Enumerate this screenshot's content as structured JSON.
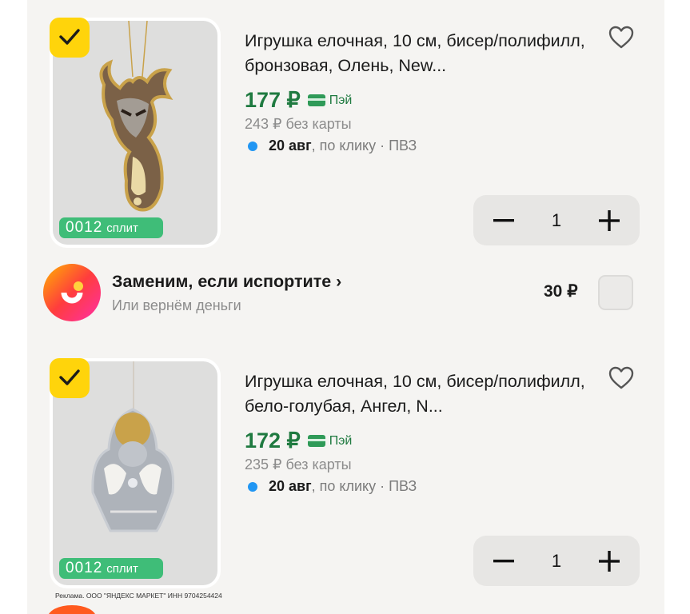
{
  "products": [
    {
      "title": "Игрушка елочная, 10 см, бисер/полифилл, бронзовая, Олень, New...",
      "price": "177 ₽",
      "pay_label": "Пэй",
      "old_price": "243 ₽ без карты",
      "delivery_date": "20 авг",
      "delivery_rest": ", по клику · ПВЗ",
      "split_num": "0012",
      "split_word": "сплит",
      "quantity": "1",
      "selected": true
    },
    {
      "title": "Игрушка елочная, 10 см, бисер/полифилл, бело-голубая, Ангел, N...",
      "price": "172 ₽",
      "pay_label": "Пэй",
      "old_price": "235 ₽ без карты",
      "delivery_date": "20 авг",
      "delivery_rest": ", по клику · ПВЗ",
      "split_num": "0012",
      "split_word": "сплит",
      "quantity": "1",
      "selected": true
    }
  ],
  "service": {
    "title": "Заменим, если испортите ›",
    "subtitle": "Или вернём деньги",
    "price": "30 ₽",
    "checked": false
  },
  "ad_disclaimer": "Реклама. ООО \"ЯНДЕКС МАРКЕТ\" ИНН 9704254424",
  "icons": {
    "checkbox": "check-icon",
    "favorite": "heart-icon",
    "card": "card-icon",
    "decrease": "minus-icon",
    "increase": "plus-icon"
  },
  "colors": {
    "price_green": "#1f7a40",
    "checkbox_yellow": "#ffd40b",
    "split_green": "#3fbd78",
    "delivery_dot": "#2196f3"
  }
}
